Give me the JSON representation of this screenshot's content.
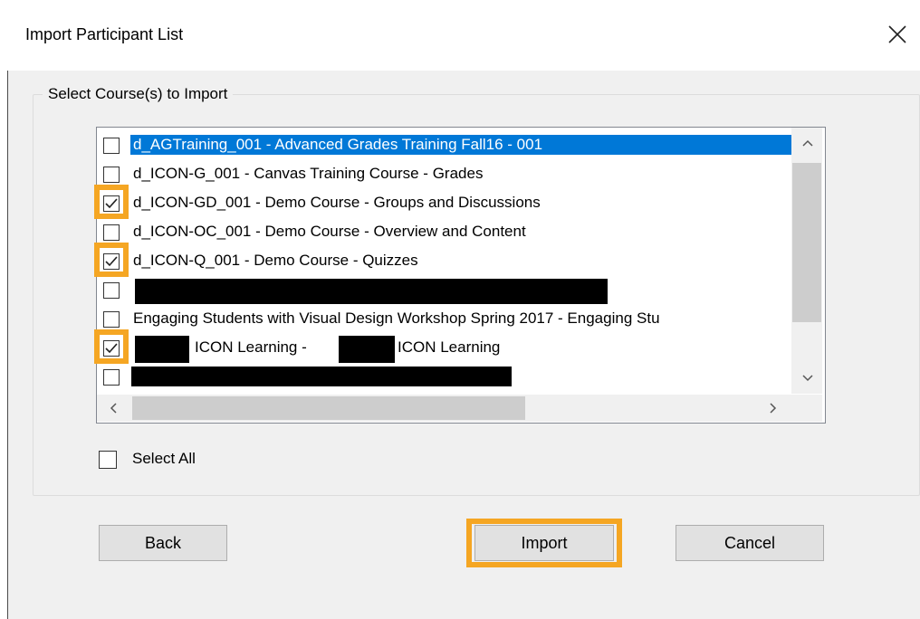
{
  "window": {
    "title": "Import Participant List",
    "close_icon": "close-icon"
  },
  "group": {
    "legend": "Select Course(s) to Import"
  },
  "courses": [
    {
      "label": "d_AGTraining_001 - Advanced Grades Training Fall16 - 001",
      "checked": false,
      "selected": true
    },
    {
      "label": "d_ICON-G_001 - Canvas Training Course - Grades",
      "checked": false
    },
    {
      "label": "d_ICON-GD_001 - Demo Course - Groups and Discussions",
      "checked": true
    },
    {
      "label": "d_ICON-OC_001 - Demo Course - Overview and Content",
      "checked": false
    },
    {
      "label": "d_ICON-Q_001 - Demo Course - Quizzes",
      "checked": true
    },
    {
      "label": "",
      "checked": false,
      "redacted": true
    },
    {
      "label": "Engaging Students with Visual Design Workshop Spring 2017 - Engaging Stu",
      "checked": false
    },
    {
      "label_part1": "ICON Learning -",
      "label_part2": "ICON Learning",
      "checked": true
    },
    {
      "label": "",
      "checked": false,
      "redacted": true
    }
  ],
  "select_all": {
    "label": "Select All",
    "checked": false
  },
  "buttons": {
    "back": "Back",
    "import": "Import",
    "cancel": "Cancel"
  },
  "colors": {
    "highlight": "#f5a623",
    "selection": "#0078d7",
    "background": "#f0f0f0"
  }
}
